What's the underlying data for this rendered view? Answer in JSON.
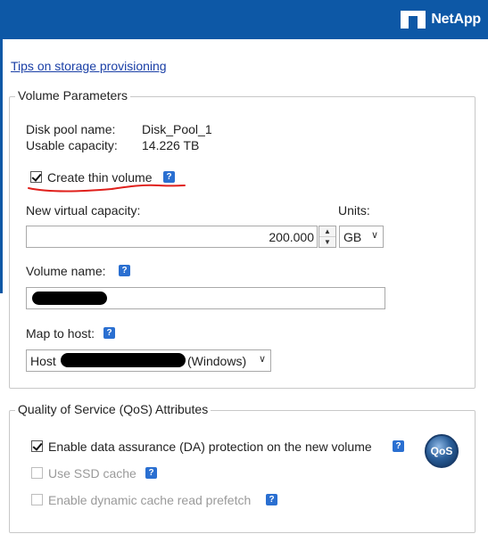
{
  "header": {
    "brand": "NetApp"
  },
  "tips_link": "Tips on storage provisioning",
  "volume_parameters": {
    "legend": "Volume Parameters",
    "disk_pool_label": "Disk pool name:",
    "disk_pool_value": "Disk_Pool_1",
    "usable_capacity_label": "Usable capacity:",
    "usable_capacity_value": "14.226 TB",
    "thin_volume_label": "Create thin volume",
    "thin_volume_checked": true,
    "virtual_capacity_label": "New virtual capacity:",
    "virtual_capacity_value": "200.000",
    "units_label": "Units:",
    "units_value": "GB",
    "volume_name_label": "Volume name:",
    "map_to_host_label": "Map to host:",
    "host_prefix": "Host",
    "host_suffix": "(Windows)"
  },
  "qos": {
    "legend": "Quality of Service (QoS) Attributes",
    "da_label": "Enable data assurance (DA) protection on the new volume",
    "da_checked": true,
    "ssd_label": "Use SSD cache",
    "prefetch_label": "Enable dynamic cache read prefetch",
    "badge": "QoS"
  },
  "icons": {
    "help": "help-icon",
    "dropdown": "chevron-down-icon",
    "logo": "netapp-logo-icon"
  },
  "colors": {
    "header_bg": "#0d58a6",
    "link": "#1a3fa6",
    "help_icon": "#2a6fd1",
    "annotation_red": "#e0201c"
  }
}
